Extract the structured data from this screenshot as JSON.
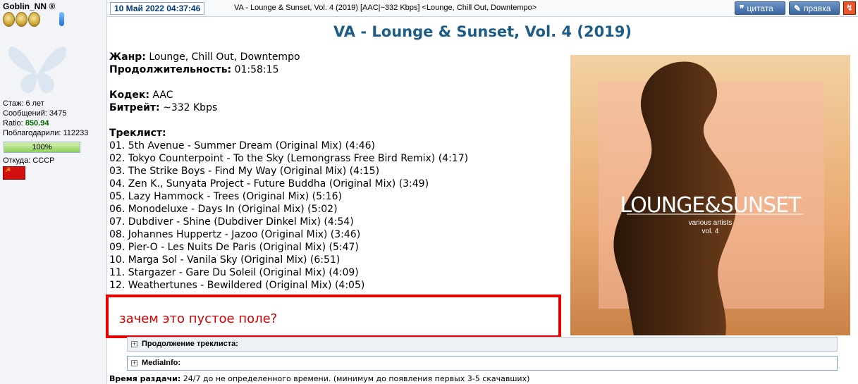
{
  "user": {
    "name": "Goblin_NN ®",
    "stats": [
      {
        "label": "Стаж:",
        "value": "6 лет"
      },
      {
        "label": "Сообщений:",
        "value": "3475"
      },
      {
        "label": "Ratio:",
        "value": "850.94"
      },
      {
        "label": "Поблагодарили:",
        "value": "112233"
      }
    ],
    "progress_label": "100%",
    "progress_fraction": 1.0,
    "from_label": "Откуда:",
    "from_value": "СССР",
    "flag_symbol": "☭"
  },
  "header": {
    "date": "10 Май 2022 04:37:46",
    "subject": "VA - Lounge & Sunset, Vol. 4 (2019) [AAC|~332 Kbps] <Lounge, Chill Out, Downtempo>",
    "quote_label": "цитата",
    "edit_label": "правка"
  },
  "release": {
    "title": "VA - Lounge & Sunset, Vol. 4 (2019)",
    "genre_label": "Жанр:",
    "genre": "Lounge, Chill Out, Downtempo",
    "duration_label": "Продолжительность:",
    "duration": "01:58:15",
    "codec_label": "Кодек:",
    "codec": "AAC",
    "bitrate_label": "Битрейт:",
    "bitrate": "~332 Kbps",
    "tracklist_label": "Треклист:",
    "tracks": [
      "01. 5th Avenue - Summer Dream (Original Mix) (4:46)",
      "02. Tokyo Counterpoint - To the Sky (Lemongrass Free Bird Remix) (4:17)",
      "03. The Strike Boys - Find My Way (Original Mix) (4:15)",
      "04. Zen K., Sunyata Project - Future Buddha (Original Mix) (3:49)",
      "05. Lazy Hammock - Trees (Original Mix) (5:16)",
      "06. Monodeluxe - Days In (Original Mix) (5:02)",
      "07. Dubdiver - Shine (Dubdiver Dinkel Mix) (4:54)",
      "08. Johannes Huppertz - Jazoo (Original Mix) (3:46)",
      "09. Pier-O - Les Nuits De Paris (Original Mix) (5:47)",
      "10. Marga Sol - Vanila Sky (Original Mix) (6:51)",
      "11. Stargazer - Gare Du Soleil (Original Mix) (4:09)",
      "12. Weathertunes - Bewildered (Original Mix) (4:05)"
    ]
  },
  "cover": {
    "brand": "LOUNGE&SUNSET",
    "subtitle": "various artists",
    "volume": "vol. 4"
  },
  "annotation": {
    "text": "зачем это пустое поле?"
  },
  "spoilers": {
    "tracklist_continued": "Продолжение треклиста:",
    "mediainfo": "MediaInfo:"
  },
  "seed_time": {
    "label": "Время раздачи:",
    "value": "24/7 до не определенного времени. (минимум до появления первых 3-5 скачавших)"
  },
  "colors": {
    "accent": "#1c5c86",
    "annotation_red": "#e60000",
    "ratio_green": "#006600"
  }
}
